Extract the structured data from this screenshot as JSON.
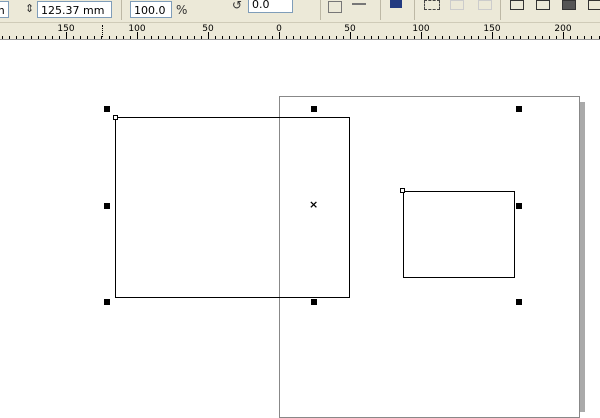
{
  "toolbar": {
    "width_partial": "m",
    "height_value": "125.37 mm",
    "scale_value": "100.0",
    "scale_unit": "%",
    "rotation_value": "0.0"
  },
  "ruler": {
    "labels": [
      "150",
      "100",
      "50",
      "0",
      "50",
      "100",
      "150",
      "200"
    ]
  }
}
